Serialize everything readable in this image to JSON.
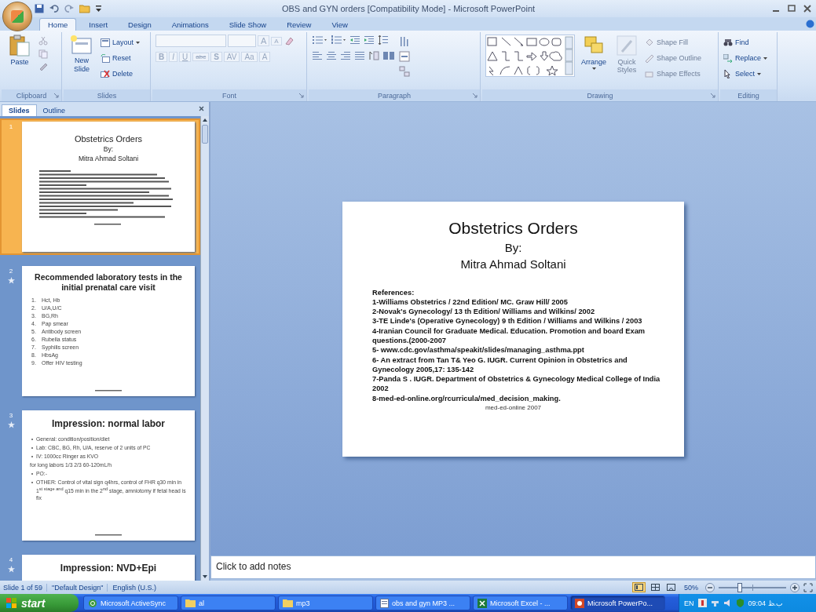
{
  "window": {
    "title": "OBS and GYN orders [Compatibility Mode] - Microsoft PowerPoint"
  },
  "tabs": [
    {
      "label": "Home",
      "selected": true
    },
    {
      "label": "Insert",
      "selected": false
    },
    {
      "label": "Design",
      "selected": false
    },
    {
      "label": "Animations",
      "selected": false
    },
    {
      "label": "Slide Show",
      "selected": false
    },
    {
      "label": "Review",
      "selected": false
    },
    {
      "label": "View",
      "selected": false
    }
  ],
  "ribbon": {
    "clipboard": {
      "label": "Clipboard",
      "paste": "Paste"
    },
    "slides": {
      "label": "Slides",
      "new_slide": "New Slide",
      "commands": [
        {
          "label": "Layout",
          "kind": "layout",
          "dropdown": true
        },
        {
          "label": "Reset",
          "kind": "reset",
          "dropdown": false
        },
        {
          "label": "Delete",
          "kind": "delete",
          "dropdown": false
        }
      ]
    },
    "font": {
      "label": "Font",
      "disabled": true,
      "size_buttons": [
        "A",
        "A"
      ],
      "format_buttons": [
        "B",
        "I",
        "U",
        "abc",
        "S",
        "AV",
        "Aa",
        "A"
      ]
    },
    "paragraph": {
      "label": "Paragraph"
    },
    "drawing": {
      "label": "Drawing",
      "arrange": "Arrange",
      "quick_styles": {
        "label": "Quick Styles",
        "disabled": true
      },
      "commands": [
        {
          "label": "Shape Fill",
          "kind": "fill",
          "disabled": true
        },
        {
          "label": "Shape Outline",
          "kind": "outline",
          "disabled": true
        },
        {
          "label": "Shape Effects",
          "kind": "effects",
          "disabled": true
        }
      ]
    },
    "editing": {
      "label": "Editing",
      "commands": [
        {
          "label": "Find",
          "kind": "find",
          "dropdown": false
        },
        {
          "label": "Replace",
          "kind": "replace",
          "dropdown": true
        },
        {
          "label": "Select",
          "kind": "select",
          "dropdown": true
        }
      ]
    }
  },
  "pane_tabs": [
    {
      "label": "Slides",
      "selected": true
    },
    {
      "label": "Outline",
      "selected": false
    }
  ],
  "thumbnails": [
    {
      "number": "1",
      "selected": true,
      "animated": false,
      "kind": "title",
      "title": "Obstetrics Orders",
      "lines": [
        "By:",
        "Mitra Ahmad Soltani"
      ]
    },
    {
      "number": "2",
      "selected": false,
      "animated": true,
      "kind": "list",
      "title": "Recommended laboratory tests in the initial prenatal care visit",
      "items": [
        {
          "n": "1.",
          "text": "Hct, Hb"
        },
        {
          "n": "2.",
          "text": "U/A,U/C"
        },
        {
          "n": "3.",
          "text": "BG,Rh"
        },
        {
          "n": "4.",
          "text": "Pap smear"
        },
        {
          "n": "5.",
          "text": "Antibody screen"
        },
        {
          "n": "6.",
          "text": "Rubella status"
        },
        {
          "n": "7.",
          "text": "Syphilis screen"
        },
        {
          "n": "8.",
          "text": "HbsAg"
        },
        {
          "n": "9.",
          "text": "Offer HIV testing"
        }
      ]
    },
    {
      "number": "3",
      "selected": false,
      "animated": true,
      "kind": "bullets",
      "title": "Impression: normal labor",
      "items": [
        {
          "bullet": true,
          "text": "General: condition/position/diet"
        },
        {
          "bullet": true,
          "text": "Lab: CBC, BG, Rh, U/A, reserve of 2 units of PC"
        },
        {
          "bullet": true,
          "text": "IV: 1000cc Ringer as KVO"
        },
        {
          "bullet": false,
          "text": "for long labors 1/3 2/3 60-120mL/h"
        },
        {
          "bullet": true,
          "text": "PO:-"
        },
        {
          "bullet": true,
          "text": "OTHER: Control of vital sign q4hrs, control of FHR q30 min in 1$^{st stage and}$ q15 min in the 2$^{nd}$ stage, amniotomy if fetal head is fix"
        }
      ]
    },
    {
      "number": "4",
      "selected": false,
      "animated": true,
      "kind": "partial",
      "title": "Impression: NVD+Epi"
    }
  ],
  "slide": {
    "title": "Obstetrics Orders",
    "subtitle": "By:",
    "author": "Mitra Ahmad Soltani",
    "references_heading": "References:",
    "references": [
      " 1-Williams Obstetrics / 22nd Edition/ MC. Graw Hill/ 2005",
      "2-Novak's Gynecology/ 13 th Edition/ Williams and Wilkins/ 2002",
      "3-TE Linde's (Operative Gynecology) 9 th Edition / Williams and Wilkins / 2003",
      "4-Iranian Council for Graduate Medical. Education. Promotion and board Exam questions.(2000-2007",
      "5- www.cdc.gov/asthma/speakit/slides/managing_asthma.ppt",
      "6- An extract from Tan T& Yeo G. IUGR. Current Opinion in Obstetrics and Gynecology 2005,17: 135-142",
      "7-Panda S . IUGR. Department of Obstetrics & Gynecology Medical College of India 2002",
      "8-med-ed-online.org/rcurricula/med_decision_making."
    ],
    "footer": "med-ed-online 2007"
  },
  "notes": {
    "placeholder": "Click to add notes"
  },
  "status": {
    "slide": "Slide 1 of 59",
    "theme": "\"Default Design\"",
    "language": "English (U.S.)",
    "views": [
      {
        "kind": "normal",
        "selected": true
      },
      {
        "kind": "sorter",
        "selected": false
      },
      {
        "kind": "show",
        "selected": false
      }
    ],
    "zoom": {
      "reading": "50%",
      "level": 0.3
    }
  },
  "taskbar": {
    "start": "start",
    "tasks": [
      {
        "label": "Microsoft ActiveSync",
        "kind": "sync",
        "selected": false
      },
      {
        "label": "al",
        "kind": "folder",
        "selected": false
      },
      {
        "label": "mp3",
        "kind": "folder",
        "selected": false
      },
      {
        "label": "obs and gyn MP3 ...",
        "kind": "doc",
        "selected": false
      },
      {
        "label": "Microsoft Excel - ...",
        "kind": "excel",
        "selected": false
      },
      {
        "label": "Microsoft PowerPo...",
        "kind": "ppt",
        "selected": true
      }
    ],
    "language": "EN",
    "time": "09:04 ب.ظ"
  }
}
